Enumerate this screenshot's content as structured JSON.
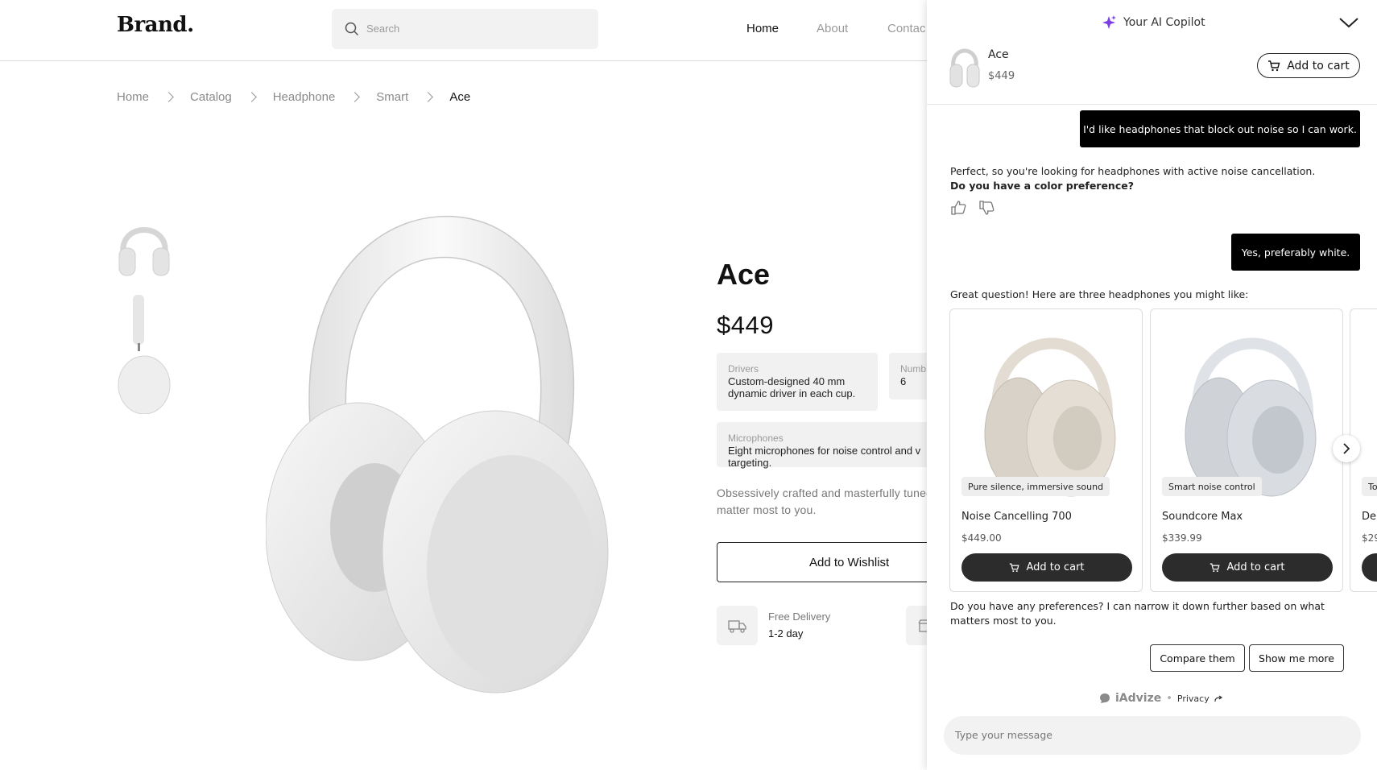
{
  "store": {
    "brand": "Brand.",
    "search_placeholder": "Search",
    "nav": [
      "Home",
      "About",
      "Contac"
    ],
    "breadcrumbs": [
      "Home",
      "Catalog",
      "Headphone",
      "Smart",
      "Ace"
    ],
    "product": {
      "title": "Ace",
      "price": "$449",
      "specs": [
        {
          "label": "Drivers",
          "value": "Custom-designed 40 mm dynamic driver in each cup."
        },
        {
          "label": "Numb",
          "value": "6"
        },
        {
          "label": "Microphones",
          "value": "Eight microphones for noise control and v targeting."
        }
      ],
      "description": "Obsessively crafted and masterfully tuned matter most to you.",
      "wishlist_label": "Add to Wishlist",
      "delivery_title": "Free Delivery",
      "delivery_time": "1-2 day"
    }
  },
  "copilot": {
    "title": "Your AI Copilot",
    "current_product": {
      "name": "Ace",
      "price": "$449"
    },
    "add_to_cart_label": "Add to cart",
    "messages": {
      "user1": "I'd like headphones that block out noise so I can work.",
      "bot1_line1": "Perfect, so you're looking for headphones with active noise cancellation.",
      "bot1_line2": "Do you have a color preference?",
      "user2": "Yes, preferably white.",
      "bot2": "Great question! Here are three headphones you might like:",
      "bot3": "Do you have any preferences? I can narrow it down further based on what matters most to you."
    },
    "products": [
      {
        "tag": "Pure silence, immersive sound",
        "name": "Noise Cancelling 700",
        "price": "$449.00",
        "cart": "Add to cart"
      },
      {
        "tag": "Smart noise control",
        "name": "Soundcore Max",
        "price": "$339.99",
        "cart": "Add to cart"
      },
      {
        "tag": "To",
        "name": "De",
        "price": "$29",
        "cart": ""
      }
    ],
    "chips": [
      "Compare them",
      "Show me more"
    ],
    "powered_by": "iAdvize",
    "privacy": "Privacy",
    "input_placeholder": "Type your message"
  }
}
